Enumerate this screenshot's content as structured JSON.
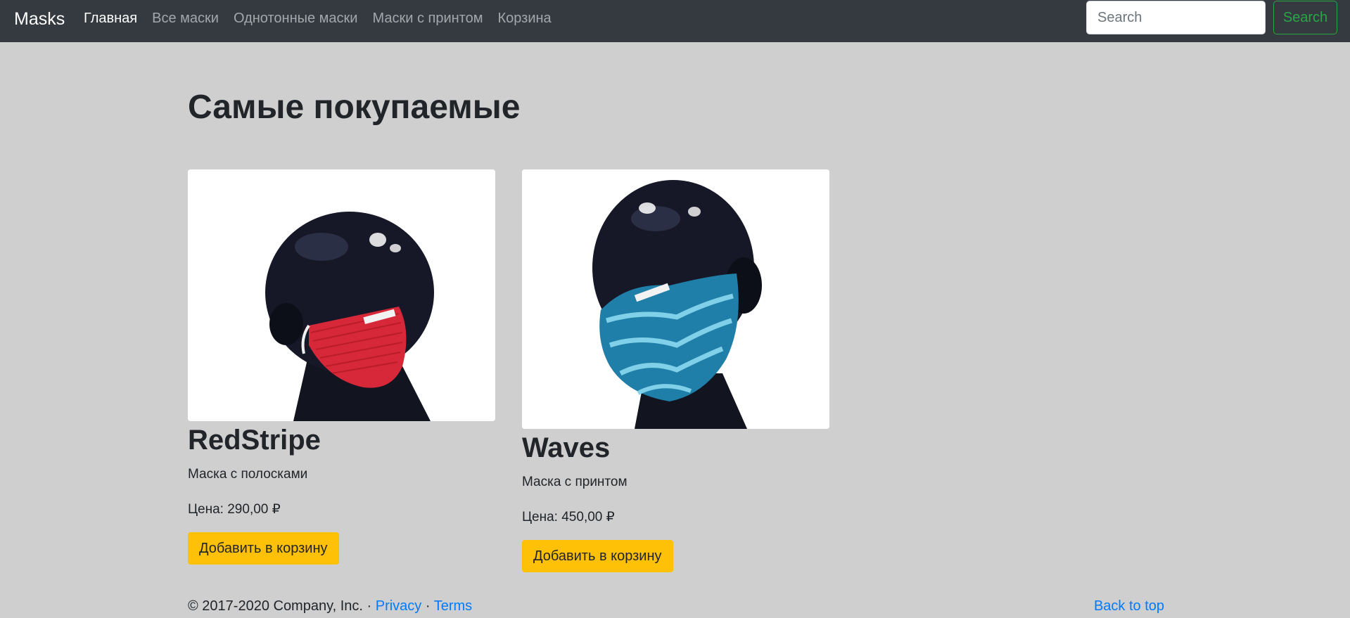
{
  "navbar": {
    "brand": "Masks",
    "links": [
      {
        "label": "Главная",
        "active": true
      },
      {
        "label": "Все маски",
        "active": false
      },
      {
        "label": "Однотонные маски",
        "active": false
      },
      {
        "label": "Маски с принтом",
        "active": false
      },
      {
        "label": "Корзина",
        "active": false
      }
    ],
    "search_placeholder": "Search",
    "search_button": "Search"
  },
  "main": {
    "title": "Самые покупаемые",
    "products": [
      {
        "name": "RedStripe",
        "description": "Маска с полосками",
        "price": "Цена: 290,00 ₽",
        "button": "Добавить в корзину",
        "mask_color": "#d7283a"
      },
      {
        "name": "Waves",
        "description": "Маска с принтом",
        "price": "Цена: 450,00 ₽",
        "button": "Добавить в корзину",
        "mask_color": "#1f7fa8"
      }
    ]
  },
  "footer": {
    "copyright": "© 2017-2020 Company, Inc. · ",
    "privacy": "Privacy",
    "separator": " · ",
    "terms": "Terms",
    "back_to_top": "Back to top"
  },
  "colors": {
    "navbar_bg": "#343a40",
    "page_bg": "#cfcfcf",
    "accent_yellow": "#ffc107",
    "search_green": "#28a745",
    "link_blue": "#007bff"
  }
}
